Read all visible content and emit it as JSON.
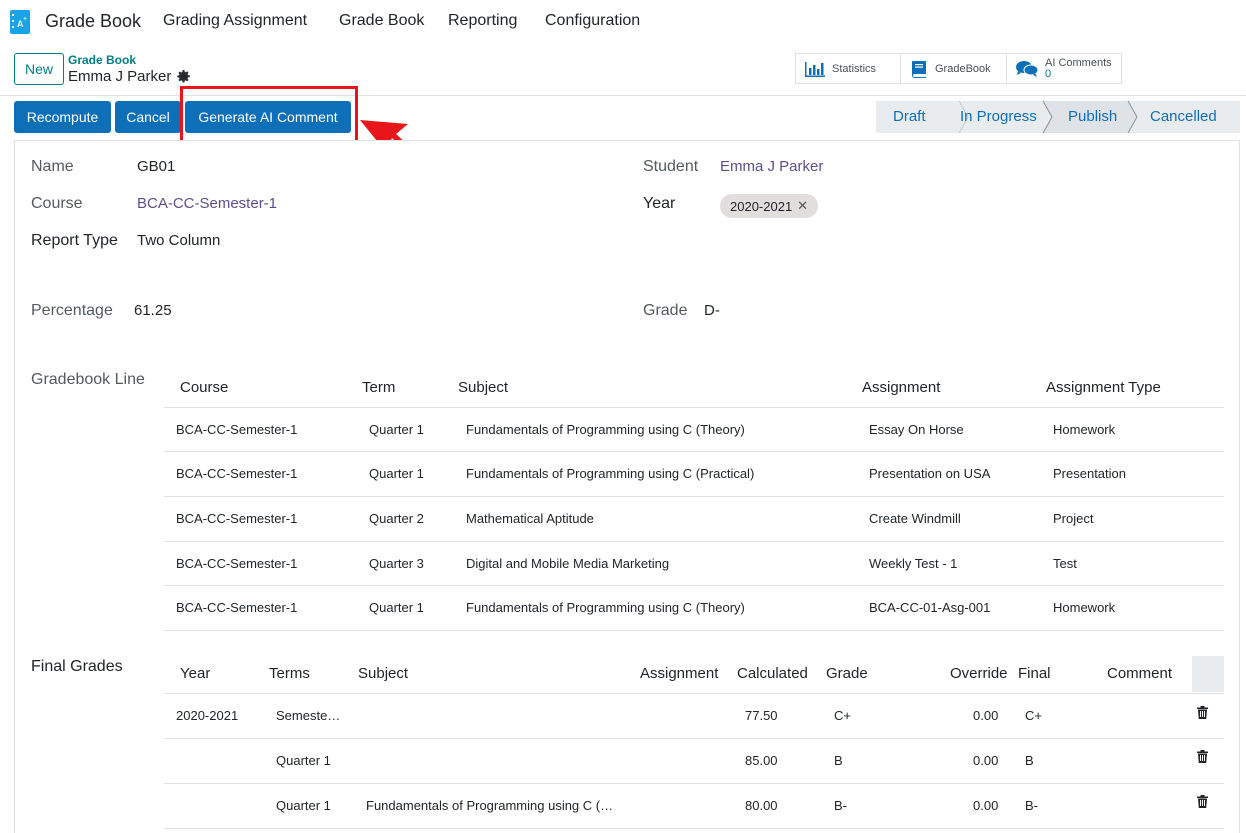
{
  "navbar": {
    "app_name": "Grade Book",
    "menus": [
      "Grading Assignment",
      "Grade Book",
      "Reporting",
      "Configuration"
    ]
  },
  "control_panel": {
    "new_label": "New",
    "breadcrumb_parent": "Grade Book",
    "breadcrumb_current": "Emma J Parker"
  },
  "smart_buttons": {
    "statistics": "Statistics",
    "gradebook": "GradeBook",
    "ai_comments": "AI Comments",
    "ai_comments_count": "0"
  },
  "actions": {
    "recompute": "Recompute",
    "cancel": "Cancel",
    "generate_ai": "Generate AI Comment"
  },
  "status_stages": [
    "Draft",
    "In Progress",
    "Publish",
    "Cancelled"
  ],
  "status_current": "Publish",
  "form": {
    "name_label": "Name",
    "name": "GB01",
    "course_label": "Course",
    "course": "BCA-CC-Semester-1",
    "report_type_label": "Report Type",
    "report_type": "Two Column",
    "student_label": "Student",
    "student": "Emma J Parker",
    "year_label": "Year",
    "year": "2020-2021",
    "percentage_label": "Percentage",
    "percentage": "61.25",
    "grade_label": "Grade",
    "grade": "D-"
  },
  "gradebook_line": {
    "label": "Gradebook Line",
    "headers": [
      "Course",
      "Term",
      "Subject",
      "Assignment",
      "Assignment Type"
    ],
    "rows": [
      [
        "BCA-CC-Semester-1",
        "Quarter 1",
        "Fundamentals of Programming using C (Theory)",
        "Essay On Horse",
        "Homework"
      ],
      [
        "BCA-CC-Semester-1",
        "Quarter 1",
        "Fundamentals of Programming using C (Practical)",
        "Presentation on USA",
        "Presentation"
      ],
      [
        "BCA-CC-Semester-1",
        "Quarter 2",
        "Mathematical Aptitude",
        "Create Windmill",
        "Project"
      ],
      [
        "BCA-CC-Semester-1",
        "Quarter 3",
        "Digital and Mobile Media Marketing",
        "Weekly Test - 1",
        "Test"
      ],
      [
        "BCA-CC-Semester-1",
        "Quarter 1",
        "Fundamentals of Programming using C (Theory)",
        "BCA-CC-01-Asg-001",
        "Homework"
      ]
    ]
  },
  "final_grades": {
    "label": "Final Grades",
    "headers": [
      "Year",
      "Terms",
      "Subject",
      "Assignment",
      "Calculated",
      "Grade",
      "Override",
      "Final",
      "Comment"
    ],
    "rows": [
      [
        "2020-2021",
        "Semeste…",
        "",
        "",
        "77.50",
        "C+",
        "0.00",
        "C+",
        ""
      ],
      [
        "",
        "Quarter 1",
        "",
        "",
        "85.00",
        "B",
        "0.00",
        "B",
        ""
      ],
      [
        "",
        "Quarter 1",
        "Fundamentals of Programming using C (…",
        "",
        "80.00",
        "B-",
        "0.00",
        "B-",
        ""
      ]
    ]
  },
  "colors": {
    "primary": "#0d6fb8",
    "accent": "#017e84",
    "highlight": "#e8151a"
  }
}
